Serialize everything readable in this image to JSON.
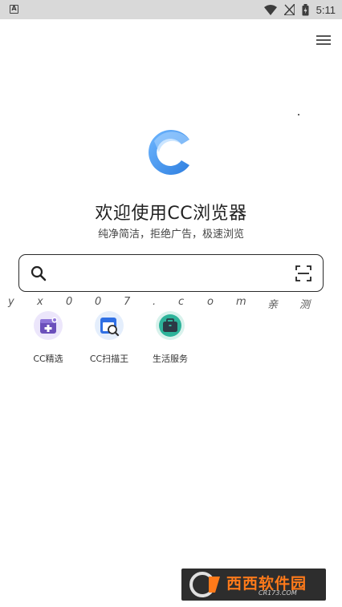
{
  "status_bar": {
    "notification_glyph": "A",
    "icons": [
      "wifi-icon",
      "signal-off-icon",
      "battery-charging-icon"
    ],
    "time": "5:11"
  },
  "header": {
    "menu_icon": "menu-icon"
  },
  "hero": {
    "title": "欢迎使用CC浏览器",
    "subtitle": "纯净简洁，拒绝广告，极速浏览",
    "logo_color": "#4a90e8"
  },
  "search": {
    "value": "",
    "placeholder": "",
    "left_icon": "search-icon",
    "right_icon": "scan-icon"
  },
  "watermark": [
    "y",
    "x",
    "0",
    "0",
    "7",
    ".",
    "c",
    "o",
    "m",
    "亲",
    "测"
  ],
  "shortcuts": [
    {
      "label": "CC精选",
      "icon": "cc-picks-icon",
      "color": "#6b4fbb"
    },
    {
      "label": "CC扫描王",
      "icon": "cc-scanner-icon",
      "color": "#2f6fe4"
    },
    {
      "label": "生活服务",
      "icon": "life-services-icon",
      "color": "#2db39a"
    }
  ],
  "corner_badge": {
    "title": "西西软件园",
    "domain": "CR173.COM"
  }
}
